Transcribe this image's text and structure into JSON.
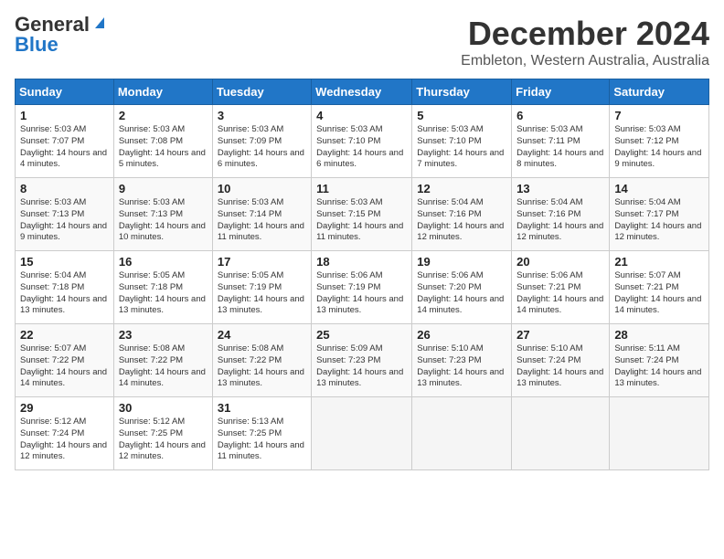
{
  "logo": {
    "general": "General",
    "blue": "Blue"
  },
  "title": "December 2024",
  "location": "Embleton, Western Australia, Australia",
  "headers": [
    "Sunday",
    "Monday",
    "Tuesday",
    "Wednesday",
    "Thursday",
    "Friday",
    "Saturday"
  ],
  "weeks": [
    [
      {
        "day": "1",
        "sunrise": "5:03 AM",
        "sunset": "7:07 PM",
        "daylight": "14 hours and 4 minutes."
      },
      {
        "day": "2",
        "sunrise": "5:03 AM",
        "sunset": "7:08 PM",
        "daylight": "14 hours and 5 minutes."
      },
      {
        "day": "3",
        "sunrise": "5:03 AM",
        "sunset": "7:09 PM",
        "daylight": "14 hours and 6 minutes."
      },
      {
        "day": "4",
        "sunrise": "5:03 AM",
        "sunset": "7:10 PM",
        "daylight": "14 hours and 6 minutes."
      },
      {
        "day": "5",
        "sunrise": "5:03 AM",
        "sunset": "7:10 PM",
        "daylight": "14 hours and 7 minutes."
      },
      {
        "day": "6",
        "sunrise": "5:03 AM",
        "sunset": "7:11 PM",
        "daylight": "14 hours and 8 minutes."
      },
      {
        "day": "7",
        "sunrise": "5:03 AM",
        "sunset": "7:12 PM",
        "daylight": "14 hours and 9 minutes."
      }
    ],
    [
      {
        "day": "8",
        "sunrise": "5:03 AM",
        "sunset": "7:13 PM",
        "daylight": "14 hours and 9 minutes."
      },
      {
        "day": "9",
        "sunrise": "5:03 AM",
        "sunset": "7:13 PM",
        "daylight": "14 hours and 10 minutes."
      },
      {
        "day": "10",
        "sunrise": "5:03 AM",
        "sunset": "7:14 PM",
        "daylight": "14 hours and 11 minutes."
      },
      {
        "day": "11",
        "sunrise": "5:03 AM",
        "sunset": "7:15 PM",
        "daylight": "14 hours and 11 minutes."
      },
      {
        "day": "12",
        "sunrise": "5:04 AM",
        "sunset": "7:16 PM",
        "daylight": "14 hours and 12 minutes."
      },
      {
        "day": "13",
        "sunrise": "5:04 AM",
        "sunset": "7:16 PM",
        "daylight": "14 hours and 12 minutes."
      },
      {
        "day": "14",
        "sunrise": "5:04 AM",
        "sunset": "7:17 PM",
        "daylight": "14 hours and 12 minutes."
      }
    ],
    [
      {
        "day": "15",
        "sunrise": "5:04 AM",
        "sunset": "7:18 PM",
        "daylight": "14 hours and 13 minutes."
      },
      {
        "day": "16",
        "sunrise": "5:05 AM",
        "sunset": "7:18 PM",
        "daylight": "14 hours and 13 minutes."
      },
      {
        "day": "17",
        "sunrise": "5:05 AM",
        "sunset": "7:19 PM",
        "daylight": "14 hours and 13 minutes."
      },
      {
        "day": "18",
        "sunrise": "5:06 AM",
        "sunset": "7:19 PM",
        "daylight": "14 hours and 13 minutes."
      },
      {
        "day": "19",
        "sunrise": "5:06 AM",
        "sunset": "7:20 PM",
        "daylight": "14 hours and 14 minutes."
      },
      {
        "day": "20",
        "sunrise": "5:06 AM",
        "sunset": "7:21 PM",
        "daylight": "14 hours and 14 minutes."
      },
      {
        "day": "21",
        "sunrise": "5:07 AM",
        "sunset": "7:21 PM",
        "daylight": "14 hours and 14 minutes."
      }
    ],
    [
      {
        "day": "22",
        "sunrise": "5:07 AM",
        "sunset": "7:22 PM",
        "daylight": "14 hours and 14 minutes."
      },
      {
        "day": "23",
        "sunrise": "5:08 AM",
        "sunset": "7:22 PM",
        "daylight": "14 hours and 14 minutes."
      },
      {
        "day": "24",
        "sunrise": "5:08 AM",
        "sunset": "7:22 PM",
        "daylight": "14 hours and 13 minutes."
      },
      {
        "day": "25",
        "sunrise": "5:09 AM",
        "sunset": "7:23 PM",
        "daylight": "14 hours and 13 minutes."
      },
      {
        "day": "26",
        "sunrise": "5:10 AM",
        "sunset": "7:23 PM",
        "daylight": "14 hours and 13 minutes."
      },
      {
        "day": "27",
        "sunrise": "5:10 AM",
        "sunset": "7:24 PM",
        "daylight": "14 hours and 13 minutes."
      },
      {
        "day": "28",
        "sunrise": "5:11 AM",
        "sunset": "7:24 PM",
        "daylight": "14 hours and 13 minutes."
      }
    ],
    [
      {
        "day": "29",
        "sunrise": "5:12 AM",
        "sunset": "7:24 PM",
        "daylight": "14 hours and 12 minutes."
      },
      {
        "day": "30",
        "sunrise": "5:12 AM",
        "sunset": "7:25 PM",
        "daylight": "14 hours and 12 minutes."
      },
      {
        "day": "31",
        "sunrise": "5:13 AM",
        "sunset": "7:25 PM",
        "daylight": "14 hours and 11 minutes."
      },
      null,
      null,
      null,
      null
    ]
  ]
}
